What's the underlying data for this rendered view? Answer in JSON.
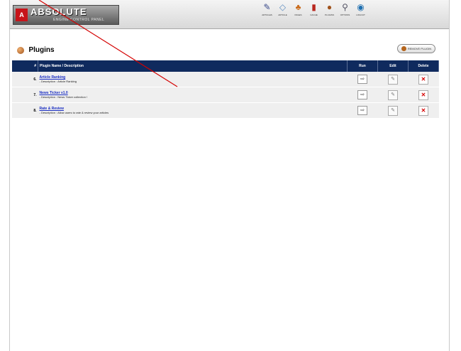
{
  "brand": {
    "logo_mark": "A",
    "name": "ABSOLUTE",
    "tagline": "ENGINE CONTROL PANEL"
  },
  "nav": [
    {
      "label": "ARTICLES",
      "icon": "pen-icon",
      "glyph": "✎"
    },
    {
      "label": "ARTICLE",
      "icon": "layers-icon",
      "glyph": "◇"
    },
    {
      "label": "PAGES",
      "icon": "pages-icon",
      "glyph": "♣"
    },
    {
      "label": "CACHE",
      "icon": "database-icon",
      "glyph": "▮"
    },
    {
      "label": "PLUGINS",
      "icon": "plugin-icon",
      "glyph": "●"
    },
    {
      "label": "OPTIONS",
      "icon": "search-options-icon",
      "glyph": "⚲"
    },
    {
      "label": "LOGOUT",
      "icon": "globe-icon",
      "glyph": "◉"
    }
  ],
  "page": {
    "title": "Plugins",
    "remove_label": "REMOVE PLUGIN"
  },
  "table": {
    "headers": {
      "num": "#",
      "name": "Plugin Name / Description",
      "run": "Run",
      "edit": "Edit",
      "delete": "Delete"
    },
    "rows": [
      {
        "num": "6.",
        "name": "Article Ranking",
        "desc": "- Description : Article Ranking"
      },
      {
        "num": "7.",
        "name": "News Ticker v1.0",
        "desc": "- Description : News Ticker collection !"
      },
      {
        "num": "8.",
        "name": "Rate & Review",
        "desc": "- Description : Allow users to rate & review your articles"
      }
    ]
  }
}
